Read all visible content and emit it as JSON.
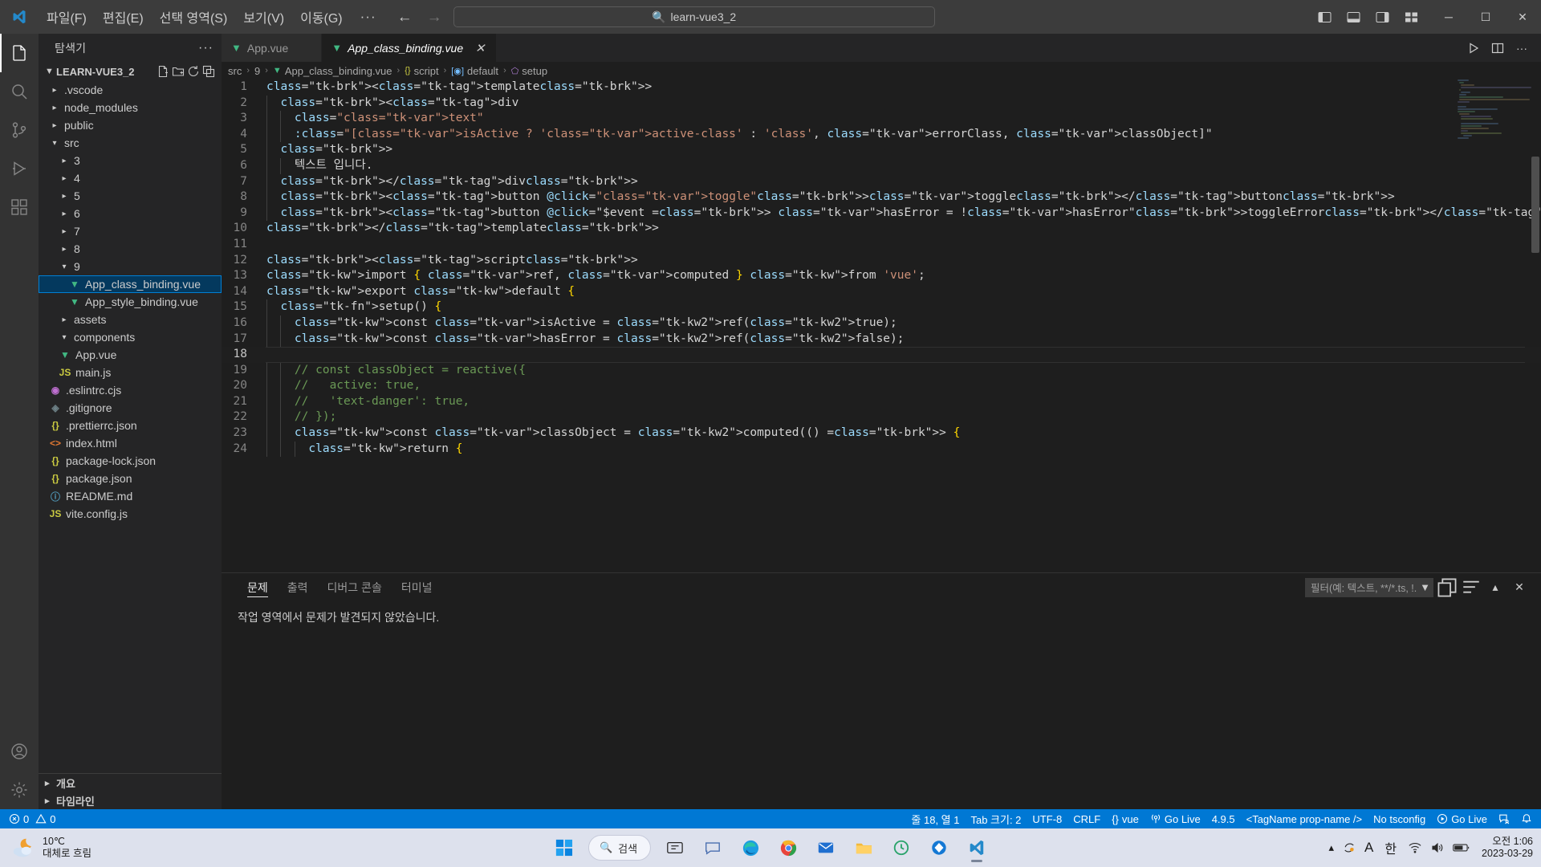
{
  "titlebar": {
    "logo_icon": "vscode-logo",
    "menus": [
      "파일(F)",
      "편집(E)",
      "선택 영역(S)",
      "보기(V)",
      "이동(G)"
    ],
    "more_label": "···",
    "back_icon": "arrow-left-icon",
    "forward_icon": "arrow-right-icon",
    "search_value": "learn-vue3_2",
    "search_icon": "search-icon",
    "layout_icons": [
      "toggle-primary-sidebar-icon",
      "toggle-panel-icon",
      "toggle-secondary-sidebar-icon",
      "customize-layout-icon"
    ],
    "minimize_label": "─",
    "maximize_label": "☐",
    "close_label": "✕"
  },
  "activitybar": {
    "items": [
      {
        "name": "explorer",
        "icon": "files-icon",
        "active": true
      },
      {
        "name": "search",
        "icon": "search-icon",
        "active": false
      },
      {
        "name": "source-control",
        "icon": "source-control-icon",
        "active": false
      },
      {
        "name": "run-and-debug",
        "icon": "debug-icon",
        "active": false
      },
      {
        "name": "extensions",
        "icon": "extensions-icon",
        "active": false
      }
    ],
    "bottom": [
      {
        "name": "accounts",
        "icon": "account-icon"
      },
      {
        "name": "settings",
        "icon": "gear-icon"
      }
    ]
  },
  "sidebar": {
    "title": "탐색기",
    "more_actions_label": "···",
    "root_label": "LEARN-VUE3_2",
    "root_actions": [
      "new-file-icon",
      "new-folder-icon",
      "refresh-icon",
      "collapse-all-icon"
    ],
    "tree": [
      {
        "label": ".vscode",
        "depth": 1,
        "type": "folder",
        "expanded": false,
        "icon": "chevron-right-icon"
      },
      {
        "label": "node_modules",
        "depth": 1,
        "type": "folder",
        "expanded": false,
        "icon": "chevron-right-icon"
      },
      {
        "label": "public",
        "depth": 1,
        "type": "folder",
        "expanded": false,
        "icon": "chevron-right-icon"
      },
      {
        "label": "src",
        "depth": 1,
        "type": "folder",
        "expanded": true,
        "icon": "chevron-down-icon"
      },
      {
        "label": "3",
        "depth": 2,
        "type": "folder",
        "expanded": false,
        "icon": "chevron-right-icon"
      },
      {
        "label": "4",
        "depth": 2,
        "type": "folder",
        "expanded": false,
        "icon": "chevron-right-icon"
      },
      {
        "label": "5",
        "depth": 2,
        "type": "folder",
        "expanded": false,
        "icon": "chevron-right-icon"
      },
      {
        "label": "6",
        "depth": 2,
        "type": "folder",
        "expanded": false,
        "icon": "chevron-right-icon"
      },
      {
        "label": "7",
        "depth": 2,
        "type": "folder",
        "expanded": false,
        "icon": "chevron-right-icon"
      },
      {
        "label": "8",
        "depth": 2,
        "type": "folder",
        "expanded": false,
        "icon": "chevron-right-icon"
      },
      {
        "label": "9",
        "depth": 2,
        "type": "folder",
        "expanded": true,
        "icon": "chevron-down-icon"
      },
      {
        "label": "App_class_binding.vue",
        "depth": 3,
        "type": "file",
        "icon": "vue-file-icon",
        "selected": true
      },
      {
        "label": "App_style_binding.vue",
        "depth": 3,
        "type": "file",
        "icon": "vue-file-icon"
      },
      {
        "label": "assets",
        "depth": 2,
        "type": "folder",
        "expanded": false,
        "icon": "chevron-right-icon"
      },
      {
        "label": "components",
        "depth": 2,
        "type": "folder",
        "expanded": true,
        "icon": "chevron-down-icon"
      },
      {
        "label": "App.vue",
        "depth": 2,
        "type": "file",
        "icon": "vue-file-icon"
      },
      {
        "label": "main.js",
        "depth": 2,
        "type": "file",
        "icon": "js-file-icon"
      },
      {
        "label": ".eslintrc.cjs",
        "depth": 1,
        "type": "file",
        "icon": "eslint-file-icon"
      },
      {
        "label": ".gitignore",
        "depth": 1,
        "type": "file",
        "icon": "git-file-icon"
      },
      {
        "label": ".prettierrc.json",
        "depth": 1,
        "type": "file",
        "icon": "json-file-icon"
      },
      {
        "label": "index.html",
        "depth": 1,
        "type": "file",
        "icon": "html-file-icon"
      },
      {
        "label": "package-lock.json",
        "depth": 1,
        "type": "file",
        "icon": "json-file-icon"
      },
      {
        "label": "package.json",
        "depth": 1,
        "type": "file",
        "icon": "json-file-icon"
      },
      {
        "label": "README.md",
        "depth": 1,
        "type": "file",
        "icon": "markdown-file-icon"
      },
      {
        "label": "vite.config.js",
        "depth": 1,
        "type": "file",
        "icon": "js-file-icon"
      }
    ],
    "bottom_sections": [
      {
        "label": "개요",
        "expanded": false,
        "icon": "chevron-right-icon"
      },
      {
        "label": "타임라인",
        "expanded": false,
        "icon": "chevron-right-icon"
      }
    ]
  },
  "editor": {
    "tabs": [
      {
        "label": "App.vue",
        "icon": "vue-file-icon",
        "active": false
      },
      {
        "label": "App_class_binding.vue",
        "icon": "vue-file-icon",
        "active": true,
        "close_label": "✕"
      }
    ],
    "tab_actions": [
      "run-icon",
      "split-editor-icon",
      "more-actions-icon"
    ],
    "breadcrumb": [
      {
        "label": "src",
        "icon": ""
      },
      {
        "label": "9",
        "icon": ""
      },
      {
        "label": "App_class_binding.vue",
        "icon": "vue-file-icon"
      },
      {
        "label": "script",
        "icon": "braces-icon"
      },
      {
        "label": "default",
        "icon": "module-icon"
      },
      {
        "label": "setup",
        "icon": "method-icon"
      }
    ],
    "breadcrumb_separator": "›",
    "active_line": 18,
    "lines": [
      {
        "n": 1,
        "code": "<template>"
      },
      {
        "n": 2,
        "code": "  <div"
      },
      {
        "n": 3,
        "code": "    class=\"text\""
      },
      {
        "n": 4,
        "code": "    :class=\"[isActive ? 'active-class' : 'class', errorClass, classObject]\""
      },
      {
        "n": 5,
        "code": "  >"
      },
      {
        "n": 6,
        "code": "    텍스트 입니다."
      },
      {
        "n": 7,
        "code": "  </div>"
      },
      {
        "n": 8,
        "code": "  <button @click=\"toggle\">toggle</button>"
      },
      {
        "n": 9,
        "code": "  <button @click=\"$event => hasError = !hasError\">toggleError</button>"
      },
      {
        "n": 10,
        "code": "</template>"
      },
      {
        "n": 11,
        "code": ""
      },
      {
        "n": 12,
        "code": "<script>"
      },
      {
        "n": 13,
        "code": "import { ref, computed } from 'vue';"
      },
      {
        "n": 14,
        "code": "export default {"
      },
      {
        "n": 15,
        "code": "  setup() {"
      },
      {
        "n": 16,
        "code": "    const isActive = ref(true);"
      },
      {
        "n": 17,
        "code": "    const hasError = ref(false);"
      },
      {
        "n": 18,
        "code": ""
      },
      {
        "n": 19,
        "code": "    // const classObject = reactive({"
      },
      {
        "n": 20,
        "code": "    //   active: true,"
      },
      {
        "n": 21,
        "code": "    //   'text-danger': true,"
      },
      {
        "n": 22,
        "code": "    // });"
      },
      {
        "n": 23,
        "code": "    const classObject = computed(() => {"
      },
      {
        "n": 24,
        "code": "      return {"
      }
    ]
  },
  "panel": {
    "tabs": [
      "문제",
      "출력",
      "디버그 콘솔",
      "터미널"
    ],
    "active_tab": "문제",
    "filter_placeholder": "필터(예: 텍스트, **/*.ts, !...",
    "filter_icon": "funnel-icon",
    "actions": [
      "new-panel-icon",
      "clear-icon",
      "maximize-panel-icon",
      "close-panel-icon"
    ],
    "message": "작업 영역에서 문제가 발견되지 않았습니다."
  },
  "statusbar": {
    "error_icon": "error-icon",
    "error_count": "0",
    "warning_icon": "warning-icon",
    "warning_count": "0",
    "cursor_position": "줄 18, 열 1",
    "indentation": "Tab 크기: 2",
    "encoding": "UTF-8",
    "eol": "CRLF",
    "language_icon": "braces-icon",
    "language": "vue",
    "golive_left_icon": "broadcast-icon",
    "golive_left": "Go Live",
    "version": "4.9.5",
    "tagname": "<TagName prop-name />",
    "tsconfig": "No tsconfig",
    "golive_right_icon": "play-circle-icon",
    "golive_right": "Go Live",
    "feedback_icon": "feedback-icon",
    "bell_icon": "bell-icon",
    "accent_color": "#0078d4"
  },
  "taskbar": {
    "weather_temp": "10℃",
    "weather_desc": "대체로 흐림",
    "weather_icon": "partly-cloudy-night-icon",
    "start_icon": "windows-start-icon",
    "search_label": "검색",
    "search_icon": "search-icon",
    "items": [
      {
        "name": "task-view",
        "icon": "task-view-icon"
      },
      {
        "name": "chat",
        "icon": "chat-icon"
      },
      {
        "name": "edge",
        "icon": "edge-icon"
      },
      {
        "name": "chrome",
        "icon": "chrome-icon"
      },
      {
        "name": "mail",
        "icon": "mail-icon"
      },
      {
        "name": "file-explorer",
        "icon": "folder-icon"
      },
      {
        "name": "app-green",
        "icon": "circle-arrow-icon"
      },
      {
        "name": "app-blue",
        "icon": "diamond-icon"
      },
      {
        "name": "vscode",
        "icon": "vscode-icon",
        "running": true
      }
    ],
    "tray": {
      "overflow_icon": "chevron-up-icon",
      "onedrive_icon": "onedrive-sync-icon",
      "ime_a_icon": "ime-a-icon",
      "ime_ko": "한",
      "wifi_icon": "wifi-icon",
      "volume_icon": "volume-icon",
      "battery_icon": "battery-icon"
    },
    "time": "오전 1:06",
    "date": "2023-03-29"
  }
}
